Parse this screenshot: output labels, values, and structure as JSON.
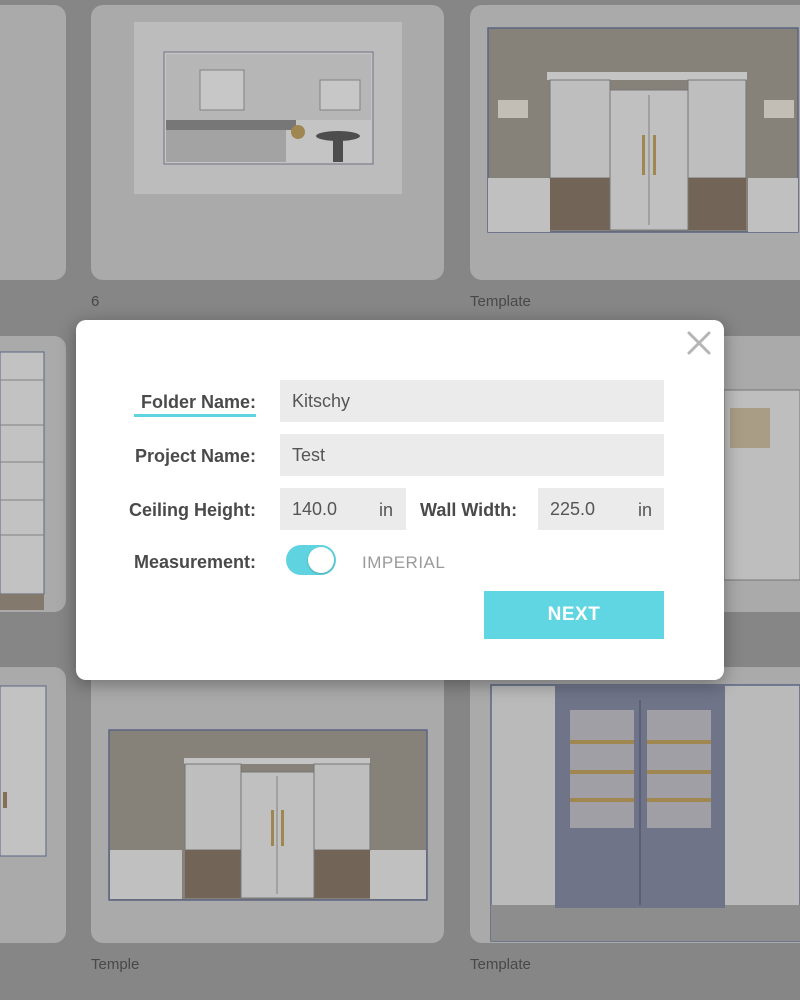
{
  "gallery": {
    "labels": [
      "6",
      "Template",
      "Temple",
      "Template"
    ]
  },
  "dialog": {
    "folder_name": {
      "label": "Folder Name:",
      "value": "Kitschy"
    },
    "project_name": {
      "label": "Project Name:",
      "value": "Test"
    },
    "ceiling_height": {
      "label": "Ceiling Height:",
      "value": "140.0",
      "unit": "in"
    },
    "wall_width": {
      "label": "Wall Width:",
      "value": "225.0",
      "unit": "in"
    },
    "measurement": {
      "label": "Measurement:",
      "mode": "IMPERIAL"
    },
    "next_label": "NEXT",
    "close_icon": "close-icon"
  },
  "colors": {
    "accent": "#5fd6e1",
    "backdrop": "#8e8e8e",
    "field_bg": "#ebebeb"
  }
}
